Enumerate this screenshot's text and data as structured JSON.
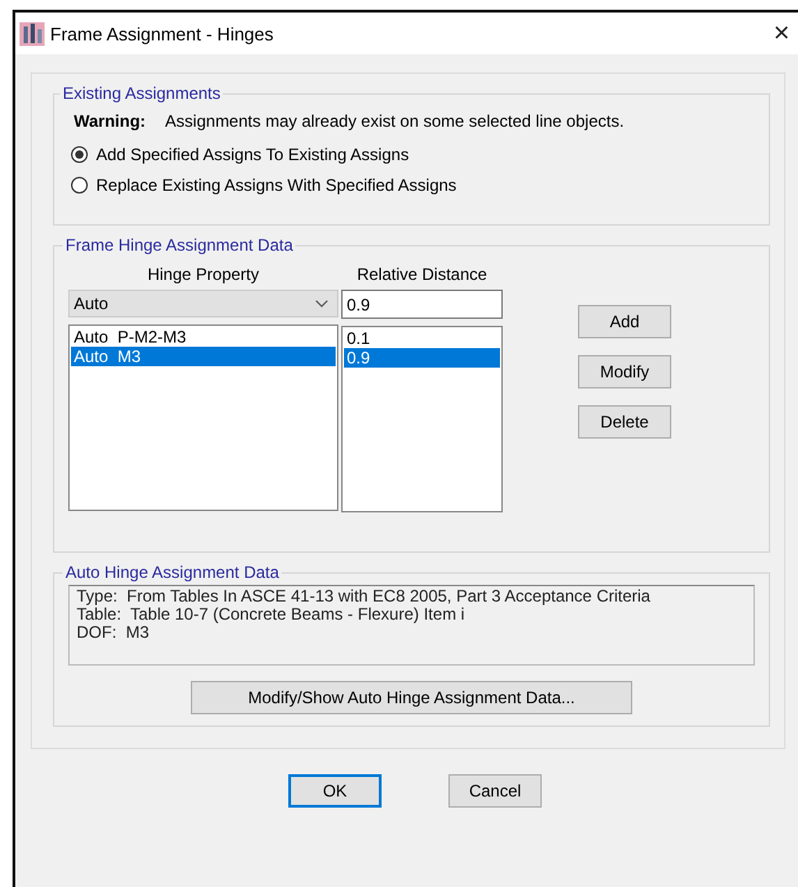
{
  "window": {
    "title": "Frame Assignment - Hinges",
    "close": "×"
  },
  "existing_assignments": {
    "title": "Existing Assignments",
    "warning_label": "Warning:",
    "warning_text": "Assignments may already exist on some selected line objects.",
    "options": [
      {
        "label": "Add Specified Assigns To Existing Assigns",
        "selected": true
      },
      {
        "label": "Replace Existing Assigns With Specified Assigns",
        "selected": false
      }
    ]
  },
  "hinge_data": {
    "title": "Frame Hinge Assignment Data",
    "columns": [
      "Hinge Property",
      "Relative Distance"
    ],
    "property_value": "Auto",
    "distance_value": "0.9",
    "rows": [
      {
        "property": "Auto  P-M2-M3",
        "distance": "0.1",
        "selected": false
      },
      {
        "property": "Auto  M3",
        "distance": "0.9",
        "selected": true
      }
    ],
    "buttons": [
      "Add",
      "Modify",
      "Delete"
    ]
  },
  "auto_hinge": {
    "title": "Auto Hinge Assignment Data",
    "lines": [
      "Type:  From Tables In ASCE 41-13 with EC8 2005, Part 3 Acceptance Criteria",
      "Table:  Table 10-7 (Concrete Beams - Flexure) Item i",
      "DOF:  M3"
    ],
    "button": "Modify/Show Auto Hinge Assignment Data..."
  },
  "buttons": [
    {
      "label": "OK",
      "default": true
    },
    {
      "label": "Cancel",
      "default": false
    }
  ]
}
